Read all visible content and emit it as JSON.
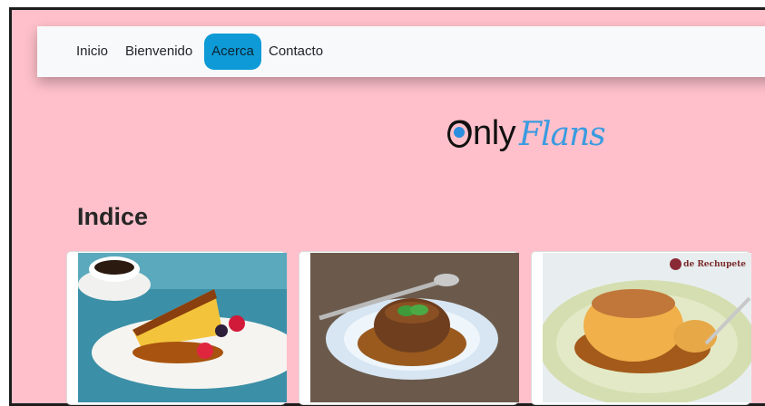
{
  "nav": {
    "items": [
      {
        "label": "Inicio"
      },
      {
        "label": "Bienvenido"
      },
      {
        "label": "Acerca"
      },
      {
        "label": "Contacto"
      }
    ],
    "active_index": 2
  },
  "brand": {
    "logo_part1": "Only",
    "logo_part2": "Flans"
  },
  "main": {
    "title": "Indice"
  },
  "cards": [
    {
      "image": "flan-slice-with-berries-photo"
    },
    {
      "image": "chocolate-flan-with-mint-photo"
    },
    {
      "image": "coconut-flan-photo",
      "watermark": "de Rechupete"
    }
  ],
  "colors": {
    "page_background": "#ffc0cb",
    "navbar_background": "#f8f9fa",
    "active_nav": "#0d9ad6",
    "logo_accent": "#3a9be0"
  }
}
